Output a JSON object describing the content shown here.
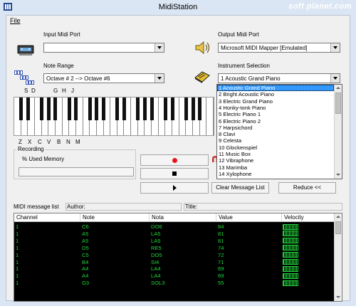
{
  "window": {
    "title": "MidiStation",
    "watermark": "soft planet.com"
  },
  "menu": {
    "file": "File"
  },
  "input_port": {
    "label": "Input Midi Port",
    "value": ""
  },
  "output_port": {
    "label": "Output Midi Port",
    "value": "Microsoft MIDI Mapper [Emulated]"
  },
  "note_range": {
    "label": "Note Range",
    "value": "Octave # 2  --> Octave #6"
  },
  "instrument": {
    "label": "Instrument Selection",
    "value": "1 Acoustic Grand Piano",
    "options": [
      "1 Acoustic Grand Piano",
      "2 Bright Acoustic Piano",
      "3 Electric Grand Piano",
      "4 Honky-tonk Piano",
      "5 Electric Piano 1",
      "6 Electric Piano 2",
      "7 Harpsichord",
      "8 Clavi",
      "9 Celesta",
      "10 Glockenspiel",
      "11 Music Box",
      "12 Vibraphone",
      "13 Marimba",
      "14 Xylophone"
    ],
    "selected_index": 0
  },
  "keys": {
    "top_letters": [
      "S",
      "D",
      "G",
      "H",
      "J"
    ],
    "bottom_letters": [
      "Z",
      "X",
      "C",
      "V",
      "B",
      "N",
      "M"
    ]
  },
  "recording": {
    "group_label": "Recording",
    "memory_label": "% Used Memory",
    "memory_used": 0
  },
  "buttons": {
    "clear": "Clear Message List",
    "reduce": "Reduce <<"
  },
  "message_list": {
    "label": "MIDI message list",
    "author_label": "Author:",
    "author_value": "",
    "title_label": "Title:",
    "title_value": "",
    "columns": [
      "Channel",
      "Note",
      "Nota",
      "Value",
      "Velocity"
    ],
    "rows": [
      [
        "1",
        "C6",
        "DO6",
        "84",
        ""
      ],
      [
        "1",
        "A5",
        "LA5",
        "81",
        ""
      ],
      [
        "1",
        "A5",
        "LA5",
        "81",
        ""
      ],
      [
        "1",
        "D5",
        "RE5",
        "74",
        ""
      ],
      [
        "1",
        "C5",
        "DO5",
        "72",
        ""
      ],
      [
        "1",
        "B4",
        "SI4",
        "71",
        ""
      ],
      [
        "1",
        "A4",
        "LA4",
        "69",
        ""
      ],
      [
        "1",
        "A4",
        "LA4",
        "69",
        ""
      ],
      [
        "1",
        "G3",
        "SOL3",
        "55",
        ""
      ]
    ]
  },
  "colors": {
    "titlebar": "#dbe6f4",
    "selection": "#3399ff",
    "table_bg": "#000000",
    "table_text": "#22d43c",
    "record": "#e8151c"
  }
}
